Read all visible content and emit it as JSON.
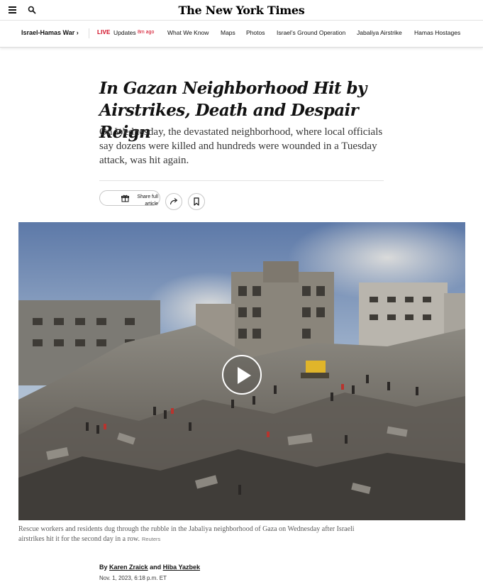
{
  "masthead": {
    "logo": "The New York Times"
  },
  "nav": {
    "section": "Israel-Hamas War",
    "section_chevron": "›",
    "live_label": "LIVE",
    "updates_label": "Updates",
    "updates_time": "8m ago",
    "links": [
      "What We Know",
      "Maps",
      "Photos",
      "Israel’s Ground Operation",
      "Jabaliya Airstrike",
      "Hamas Hostages"
    ]
  },
  "article": {
    "headline_line1": "In Gazan Neighborhood Hit by",
    "headline_line2": "Airstrikes, Death and Despair Reign",
    "summary": "On Wednesday, the devastated neighborhood, where local officials say dozens were killed and hundreds were wounded in a Tuesday attack, was hit again.",
    "share_line1": "Share full",
    "share_line2": "article",
    "icons": {
      "menu": "menu-icon",
      "search": "search-icon",
      "gift": "gift-icon",
      "share": "share-arrow-icon",
      "save": "bookmark-icon",
      "play": "play-icon"
    }
  },
  "media": {
    "caption": "Rescue workers and residents dug through the rubble in the Jabaliya neighborhood of Gaza on Wednesday after Israeli airstrikes hit it for the second day in a row.",
    "credit": "Reuters"
  },
  "byline": {
    "prefix": "By",
    "author1": "Karen Zraick",
    "conjunction": "and",
    "author2": "Hiba Yazbek",
    "date": "Nov. 1, 2023, 6:18 p.m. ET"
  }
}
